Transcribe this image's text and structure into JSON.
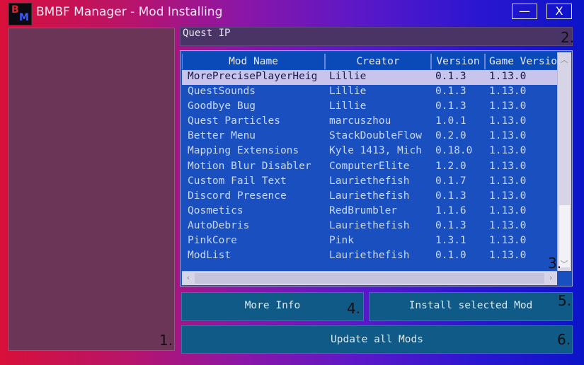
{
  "window": {
    "title": "BMBF Manager - Mod Installing",
    "icon_letters": [
      "B",
      "M"
    ],
    "minimize_label": "—",
    "close_label": "X"
  },
  "markers": [
    "1.",
    "2.",
    "3.",
    "4.",
    "5.",
    "6."
  ],
  "ip_field": {
    "value": "Quest IP"
  },
  "mods_table": {
    "columns": [
      "Mod Name",
      "Creator",
      "Version",
      "Game Versio"
    ],
    "rows": [
      [
        "MorePrecisePlayerHeig",
        "Lillie",
        "0.1.3",
        "1.13.0"
      ],
      [
        "QuestSounds",
        "Lillie",
        "0.1.3",
        "1.13.0"
      ],
      [
        "Goodbye Bug",
        "Lillie",
        "0.1.3",
        "1.13.0"
      ],
      [
        "Quest Particles",
        "marcuszhou",
        "1.0.1",
        "1.13.0"
      ],
      [
        "Better Menu",
        "StackDoubleFlow",
        "0.2.0",
        "1.13.0"
      ],
      [
        "Mapping Extensions",
        "Kyle 1413, Mich",
        "0.18.0",
        "1.13.0"
      ],
      [
        "Motion Blur Disabler",
        "ComputerElite",
        "1.2.0",
        "1.13.0"
      ],
      [
        "Custom Fail Text",
        "Lauriethefish",
        "0.1.7",
        "1.13.0"
      ],
      [
        "Discord Presence",
        "Lauriethefish",
        "0.1.3",
        "1.13.0"
      ],
      [
        "Qosmetics",
        "RedBrumbler",
        "1.1.6",
        "1.13.0"
      ],
      [
        "AutoDebris",
        "Lauriethefish",
        "0.1.3",
        "1.13.0"
      ],
      [
        "PinkCore",
        "Pink",
        "1.3.1",
        "1.13.0"
      ],
      [
        "ModList",
        "Lauriethefish",
        "0.1.0",
        "1.13.0"
      ]
    ],
    "selected_row": 0
  },
  "buttons": {
    "more_info": "More Info",
    "install_selected": "Install selected Mod",
    "update_all": "Update all Mods"
  },
  "icons": [
    "app-logo-icon",
    "minimize-icon",
    "close-icon",
    "scroll-up-icon",
    "scroll-down-icon",
    "scroll-left-icon",
    "scroll-right-icon"
  ]
}
